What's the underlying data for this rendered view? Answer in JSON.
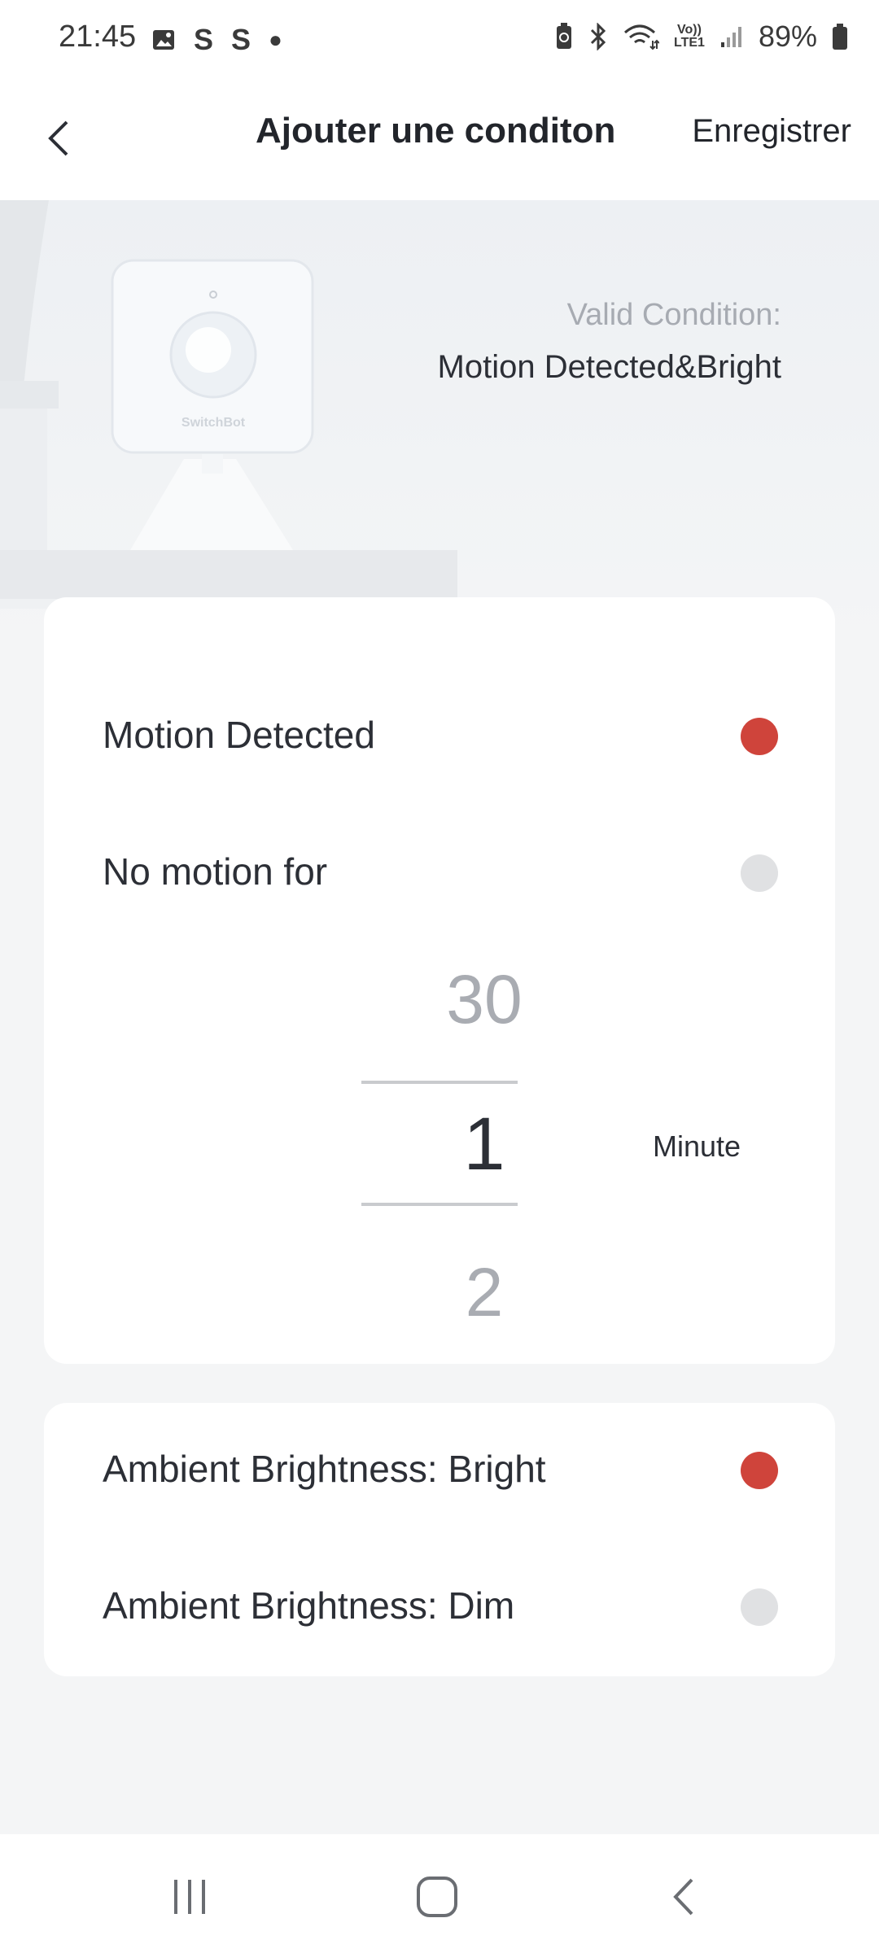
{
  "status_bar": {
    "time": "21:45",
    "left_icons": [
      "image-icon",
      "s-app-icon",
      "s-app-icon",
      "dot-icon"
    ],
    "volte_top": "Vo))",
    "volte_bottom": "LTE1",
    "battery_percent": "89%",
    "right_icons": [
      "battery-saver-icon",
      "bluetooth-icon",
      "wifi-icon",
      "volte-icon",
      "signal-icon",
      "battery-icon"
    ]
  },
  "header": {
    "title": "Ajouter une conditon",
    "save_label": "Enregistrer",
    "back_icon": "chevron-left-icon"
  },
  "hero": {
    "device_brand": "SwitchBot",
    "valid_label": "Valid Condition:",
    "valid_value": "Motion Detected&Bright"
  },
  "motion_card": {
    "options": [
      {
        "label": "Motion Detected",
        "selected": true
      },
      {
        "label": "No motion for",
        "selected": false
      }
    ],
    "picker": {
      "prev": "30",
      "current": "1",
      "next": "2",
      "unit": "Minute"
    }
  },
  "brightness_card": {
    "options": [
      {
        "label": "Ambient Brightness: Bright",
        "selected": true
      },
      {
        "label": "Ambient Brightness: Dim",
        "selected": false
      }
    ]
  },
  "colors": {
    "accent_red": "#cf443b",
    "radio_off": "#e0e1e3",
    "background": "#f4f5f6"
  },
  "nav_bar": {
    "buttons": [
      "recents-icon",
      "home-icon",
      "back-icon"
    ]
  }
}
